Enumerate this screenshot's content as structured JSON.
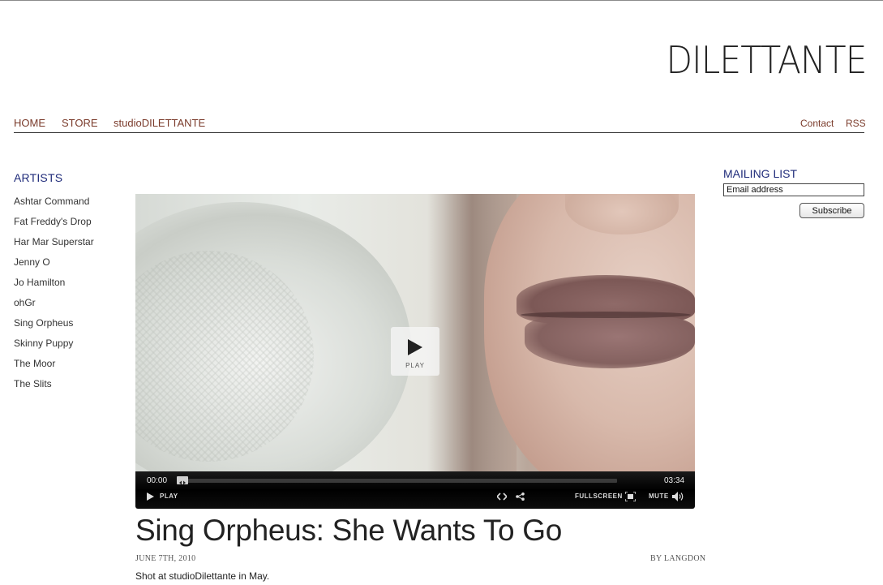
{
  "site": {
    "logo": "DILETTANTE"
  },
  "nav": {
    "left": [
      "HOME",
      "STORE",
      "studioDILETTANTE"
    ],
    "right": [
      "Contact",
      "RSS"
    ]
  },
  "artists": {
    "title": "ARTISTS",
    "items": [
      "Ashtar Command",
      "Fat Freddy's Drop",
      "Har Mar Superstar",
      "Jenny O",
      "Jo Hamilton",
      "ohGr",
      "Sing Orpheus",
      "Skinny Puppy",
      "The Moor",
      "The Slits"
    ]
  },
  "video": {
    "play_overlay": "PLAY",
    "current_time": "00:00",
    "duration": "03:34",
    "progress": 0,
    "play_label": "PLAY",
    "fullscreen_label": "FULLSCREEN",
    "mute_label": "MUTE"
  },
  "post": {
    "title": "Sing Orpheus: She Wants To Go",
    "date": "JUNE 7TH, 2010",
    "author": "BY LANGDON",
    "caption": "Shot at studioDilettante in May."
  },
  "mailing": {
    "title": "MAILING LIST",
    "placeholder": "Email address",
    "button": "Subscribe"
  },
  "colors": {
    "nav_link": "#7a3a2a",
    "section_title": "#1f2b7a"
  }
}
